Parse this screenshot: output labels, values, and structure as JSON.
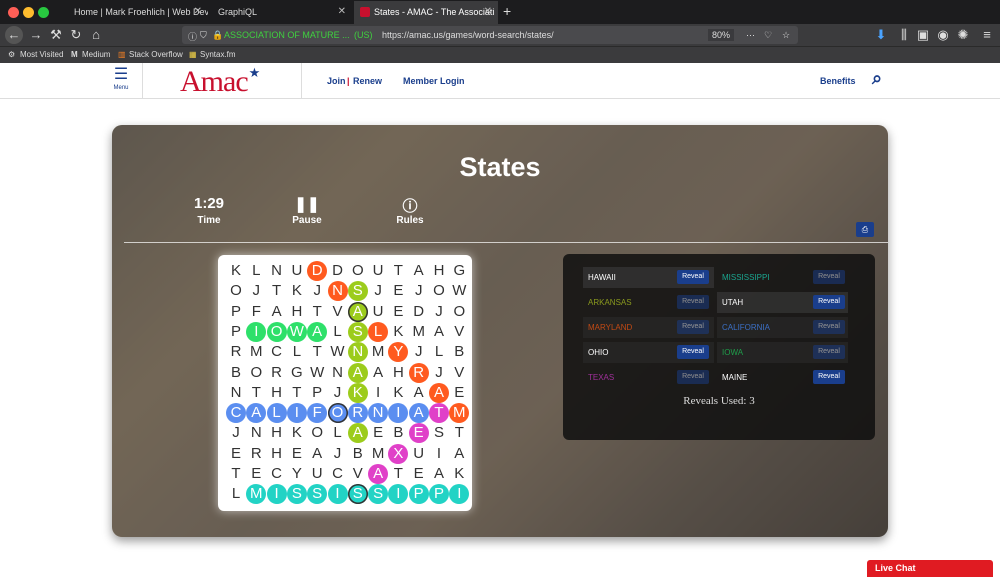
{
  "browser": {
    "tabs": [
      {
        "title": "Home | Mark Froehlich | Web Dev"
      },
      {
        "title": "GraphiQL"
      },
      {
        "title": "States - AMAC - The Associati"
      }
    ],
    "url_org": "ASSOCIATION OF MATURE ...",
    "url_country": "(US)",
    "url": "https://amac.us/games/word-search/states/",
    "zoom": "80%",
    "bookmarks": [
      "Most Visited",
      "Medium",
      "Stack Overflow",
      "Syntax.fm"
    ]
  },
  "site": {
    "menu_label": "Menu",
    "logo": "Amac",
    "join": "Join",
    "renew": "Renew",
    "login": "Member Login",
    "benefits": "Benefits"
  },
  "game": {
    "title": "States",
    "time_value": "1:29",
    "time_label": "Time",
    "pause_label": "Pause",
    "rules_label": "Rules",
    "grid": [
      "KLNUDDOUTAHG",
      "OJTKJNSJEJOWD",
      "PFAHTVAUEDJO",
      "PIOWALSLKMAV",
      "RMCLTWNMYJLB",
      "BORGWNAAHRJVA",
      "NTHTPJKIKAAE",
      "CALIFORNIATM",
      "JNHKOLAEBEST",
      "ERHEAJBMXUIA",
      "TECYUCVATEAK",
      "LMISSISSIPPI"
    ],
    "words": [
      {
        "name": "HAWAII",
        "found": false,
        "color": "#ffffff",
        "reveal": "Reveal"
      },
      {
        "name": "MISSISSIPPI",
        "found": true,
        "color": "#1aa68f",
        "reveal": "Reveal"
      },
      {
        "name": "ARKANSAS",
        "found": true,
        "color": "#8a9a1e",
        "reveal": "Reveal"
      },
      {
        "name": "UTAH",
        "found": false,
        "color": "#ffffff",
        "reveal": "Reveal"
      },
      {
        "name": "MARYLAND",
        "found": true,
        "color": "#c24a14",
        "reveal": "Reveal"
      },
      {
        "name": "CALIFORNIA",
        "found": true,
        "color": "#3b6fc4",
        "reveal": "Reveal"
      },
      {
        "name": "OHIO",
        "found": false,
        "color": "#ffffff",
        "reveal": "Reveal"
      },
      {
        "name": "IOWA",
        "found": true,
        "color": "#1e9e4a",
        "reveal": "Reveal"
      },
      {
        "name": "TEXAS",
        "found": true,
        "color": "#a0309a",
        "reveal": "Reveal"
      },
      {
        "name": "MAINE",
        "found": false,
        "color": "#ffffff",
        "reveal": "Reveal"
      }
    ],
    "reveals_used": "Reveals Used: 3"
  },
  "live_chat": "Live Chat",
  "colors": {
    "orange": "#ff5a1f",
    "lime": "#9ccc1c",
    "green": "#2ee06a",
    "blue": "#5b8ef0",
    "pink": "#e040c8",
    "teal": "#22d3c5"
  }
}
